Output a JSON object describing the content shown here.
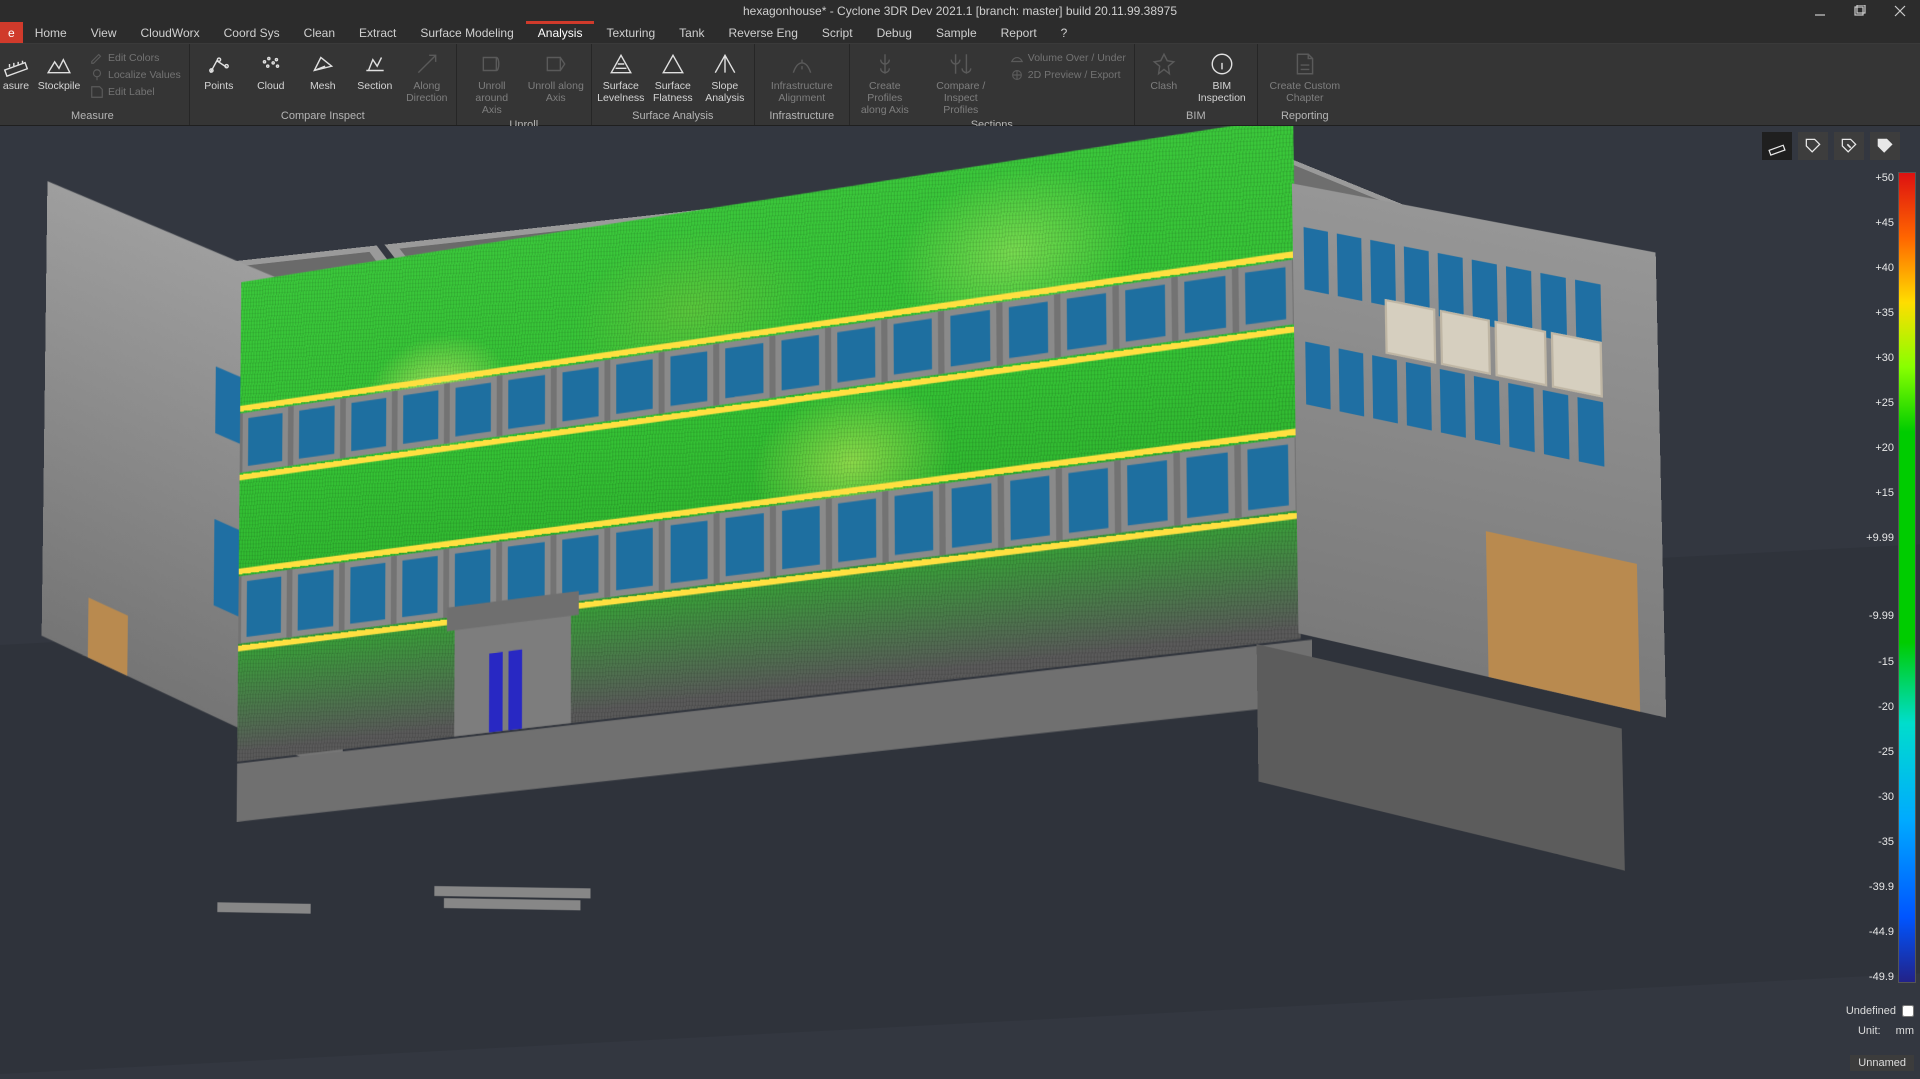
{
  "title": "hexagonhouse* - Cyclone 3DR Dev 2021.1 [branch: master] build 20.11.99.38975",
  "tabs": {
    "file": "e",
    "items": [
      "Home",
      "View",
      "CloudWorx",
      "Coord Sys",
      "Clean",
      "Extract",
      "Surface Modeling",
      "Analysis",
      "Texturing",
      "Tank",
      "Reverse Eng",
      "Script",
      "Debug",
      "Sample",
      "Report",
      "?"
    ],
    "active": "Analysis"
  },
  "ribbon": {
    "measure": {
      "title": "Measure",
      "measure": "asure",
      "stockpile": "Stockpile",
      "editColors": "Edit Colors",
      "localizeValues": "Localize Values",
      "editLabel": "Edit Label"
    },
    "compare": {
      "title": "Compare Inspect",
      "points": "Points",
      "cloud": "Cloud",
      "mesh": "Mesh",
      "section": "Section",
      "alongDir": "Along\nDirection"
    },
    "unroll": {
      "title": "Unroll",
      "aroundAxis": "Unroll around\nAxis",
      "alongAxis": "Unroll along\nAxis"
    },
    "surface": {
      "title": "Surface Analysis",
      "levelness": "Surface\nLevelness",
      "flatness": "Surface\nFlatness",
      "slope": "Slope\nAnalysis"
    },
    "infra": {
      "title": "Infrastructure",
      "alignment": "Infrastructure\nAlignment"
    },
    "sections": {
      "title": "Sections",
      "createAxis": "Create Profiles\nalong Axis",
      "compare": "Compare / Inspect\nProfiles",
      "volume": "Volume Over / Under",
      "preview": "2D Preview / Export"
    },
    "bim": {
      "title": "BIM",
      "clash": "Clash",
      "inspection": "BIM\nInspection"
    },
    "reporting": {
      "title": "Reporting",
      "custom": "Create Custom\nChapter"
    }
  },
  "legend": {
    "ticks": [
      "+50",
      "+45",
      "+40",
      "+35",
      "+30",
      "+25",
      "+20",
      "+15",
      "+9.99",
      "",
      "-9.99",
      "-15",
      "-20",
      "-25",
      "-30",
      "-35",
      "-39.9",
      "-44.9",
      "-49.9"
    ],
    "undefined": "Undefined",
    "unitLabel": "Unit:",
    "unitValue": "mm"
  },
  "status": {
    "tab": "Unnamed"
  }
}
